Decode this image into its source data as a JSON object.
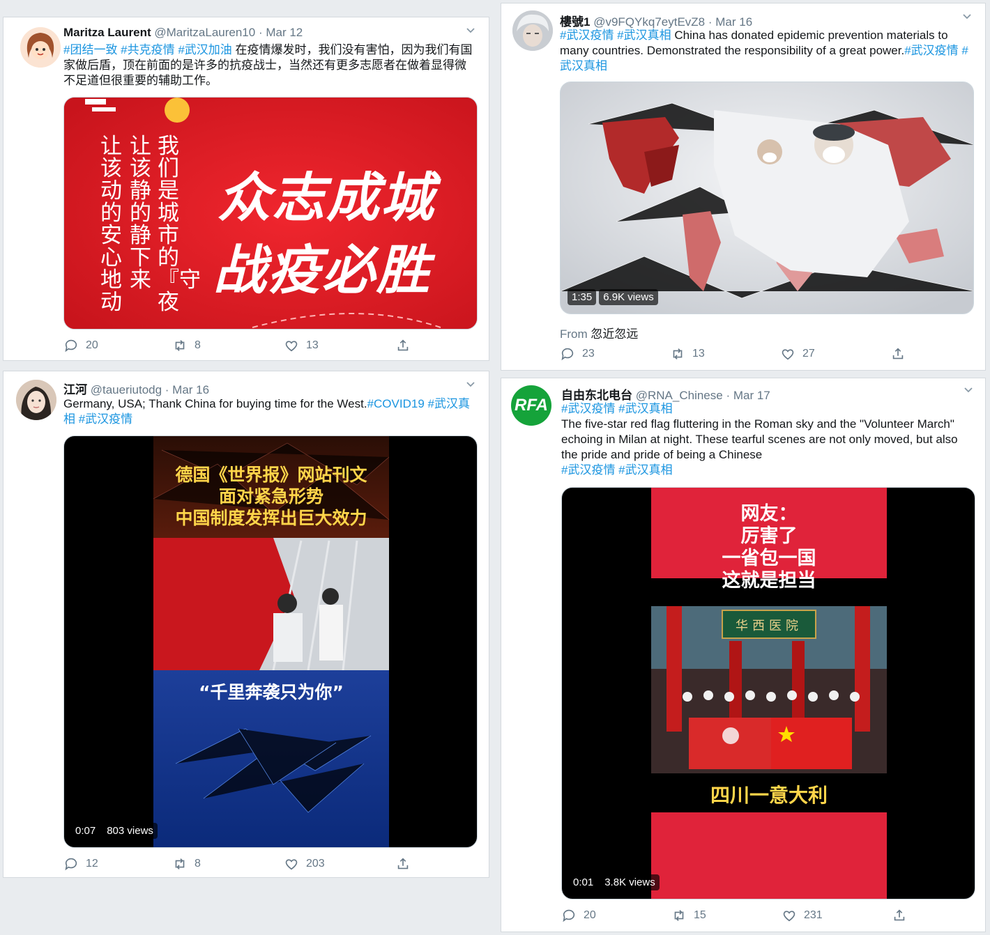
{
  "tweets": [
    {
      "name": "Maritza Laurent",
      "handle": "@MaritzaLauren10",
      "date": "· Mar 12",
      "text_tags": "#团结一致 #共克疫情 #武汉加油",
      "text_body": " 在疫情爆发时，我们没有害怕，因为我们有国家做后盾，顶在前面的是许多的抗疫战士，当然还有更多志愿者在做着显得微不足道但很重要的辅助工作。",
      "media_vertical_text": [
        "让该动的安心地动",
        "让该静的静下来",
        "我们是城市的『守夜"
      ],
      "media_slogan_1": "众志成城",
      "media_slogan_2": "战疫必胜",
      "replies": "20",
      "retweets": "8",
      "likes": "13"
    },
    {
      "name": "樓號1",
      "handle": "@v9FQYkq7eytEvZ8",
      "date": "· Mar 16",
      "text_tags_1": "#武汉疫情 #武汉真相",
      "text_body": " China has donated epidemic prevention materials to many countries. Demonstrated the responsibility of a great power.",
      "text_tags_2": "#武汉疫情 #武汉真相",
      "duration": "1:35",
      "views": "6.9K views",
      "from_label": "From",
      "from_name": "忽近忽远",
      "replies": "23",
      "retweets": "13",
      "likes": "27"
    },
    {
      "name": "江河",
      "handle": "@taueriutodg",
      "date": "· Mar 16",
      "text_body": "Germany, USA; Thank China for buying time for the West.",
      "text_tags": "#COVID19 #武汉真相 #武汉疫情",
      "media_headline": [
        "德国《世界报》网站刊文",
        "面对紧急形势",
        "中国制度发挥出巨大效力"
      ],
      "media_quote": "“千里奔袭只为你”",
      "duration": "0:07",
      "views": "803 views",
      "replies": "12",
      "retweets": "8",
      "likes": "203"
    },
    {
      "name": "自由东北电台",
      "handle": "@RNA_Chinese",
      "date": "· Mar 17",
      "avatar_text": "RFA",
      "text_tags_1": "#武汉疫情 #武汉真相",
      "text_body": "The five-star red flag fluttering in the Roman sky and the \"Volunteer March\" echoing in Milan at night. These tearful scenes are not only moved, but also the pride and pride of being a Chinese",
      "text_tags_2": "#武汉疫情 #武汉真相",
      "media_caption": [
        "网友：",
        "厉害了",
        "一省包一国",
        "这就是担当"
      ],
      "media_sign": "华西医院",
      "media_bottom": "四川一意大利",
      "duration": "0:01",
      "views": "3.8K views",
      "replies": "20",
      "retweets": "15",
      "likes": "231"
    }
  ],
  "colors": {
    "link": "#1b95e0",
    "red": "#e0232f"
  },
  "icons": [
    "reply-icon",
    "retweet-icon",
    "like-icon",
    "share-icon",
    "chevron-down-icon"
  ]
}
